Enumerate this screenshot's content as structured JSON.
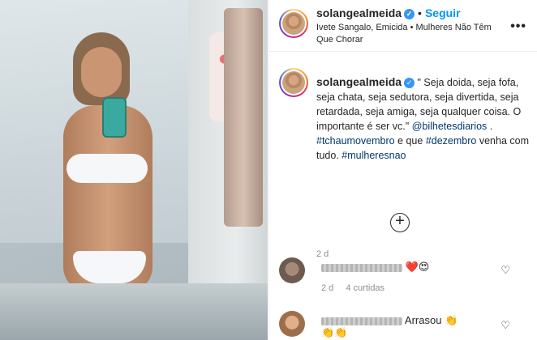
{
  "post": {
    "username": "solangealmeida",
    "follow_label": "Seguir",
    "audio_label": "Ivete Sangalo, Emicida • Mulheres Não Têm Que Chorar",
    "more_glyph": "•••",
    "verified_glyph": "✓"
  },
  "caption": {
    "username": "solangealmeida",
    "text_main": " \" Seja doida, seja fofa, seja chata, seja sedutora, seja divertida, seja retardada, seja amiga, seja qualquer coisa. O importante é ser vc.\" ",
    "mention": "@bilhetesdiarios",
    "text_after_mention": " . ",
    "hashtag1": "#tchaumovembro",
    "text_mid": " e que ",
    "hashtag2": "#dezembro",
    "text_end": " venha com tudo. ",
    "hashtag3": "#mulheresnao",
    "time": "2 d"
  },
  "load_more_glyph": "+",
  "comments": [
    {
      "emojis": "❤️😍",
      "time": "2 d",
      "likes": "4 curtidas",
      "like_glyph": "♡"
    },
    {
      "text": "Arrasou",
      "emojis_line1": "👏",
      "emojis_line2": "👏👏",
      "like_glyph": "♡"
    }
  ]
}
